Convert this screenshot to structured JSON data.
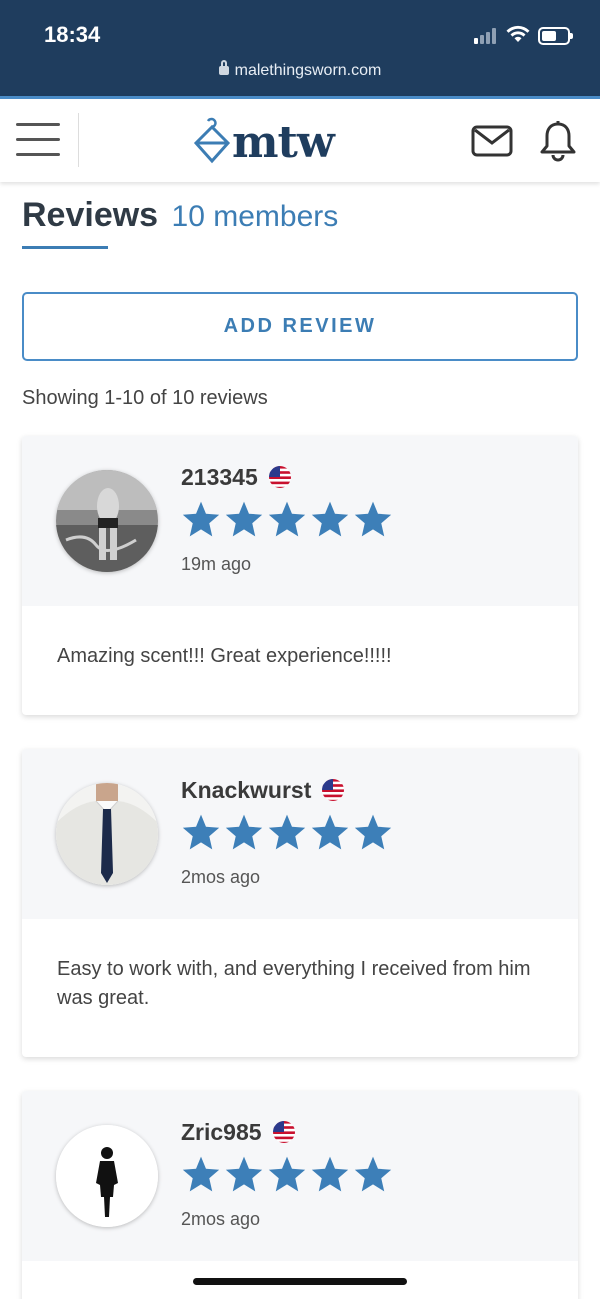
{
  "status_bar": {
    "time": "18:34",
    "url": "malethingsworn.com"
  },
  "header": {
    "logo_text": "mtw"
  },
  "page": {
    "title": "Reviews",
    "subtitle": "10 members",
    "add_review_label": "ADD REVIEW",
    "showing_text": "Showing 1-10 of 10 reviews"
  },
  "reviews": [
    {
      "username": "213345",
      "rating": 5,
      "time_ago": "19m ago",
      "text": "Amazing scent!!! Great experience!!!!!",
      "flag": "us-flag-icon"
    },
    {
      "username": "Knackwurst",
      "rating": 5,
      "time_ago": "2mos ago",
      "text": "Easy to work with, and everything I received from him was great.",
      "flag": "us-flag-icon"
    },
    {
      "username": "Zric985",
      "rating": 5,
      "time_ago": "2mos ago",
      "text": "",
      "flag": "us-flag-icon"
    }
  ],
  "colors": {
    "accent": "#3c7db4",
    "navy": "#1f3d5e",
    "star": "#3d7fb8"
  }
}
